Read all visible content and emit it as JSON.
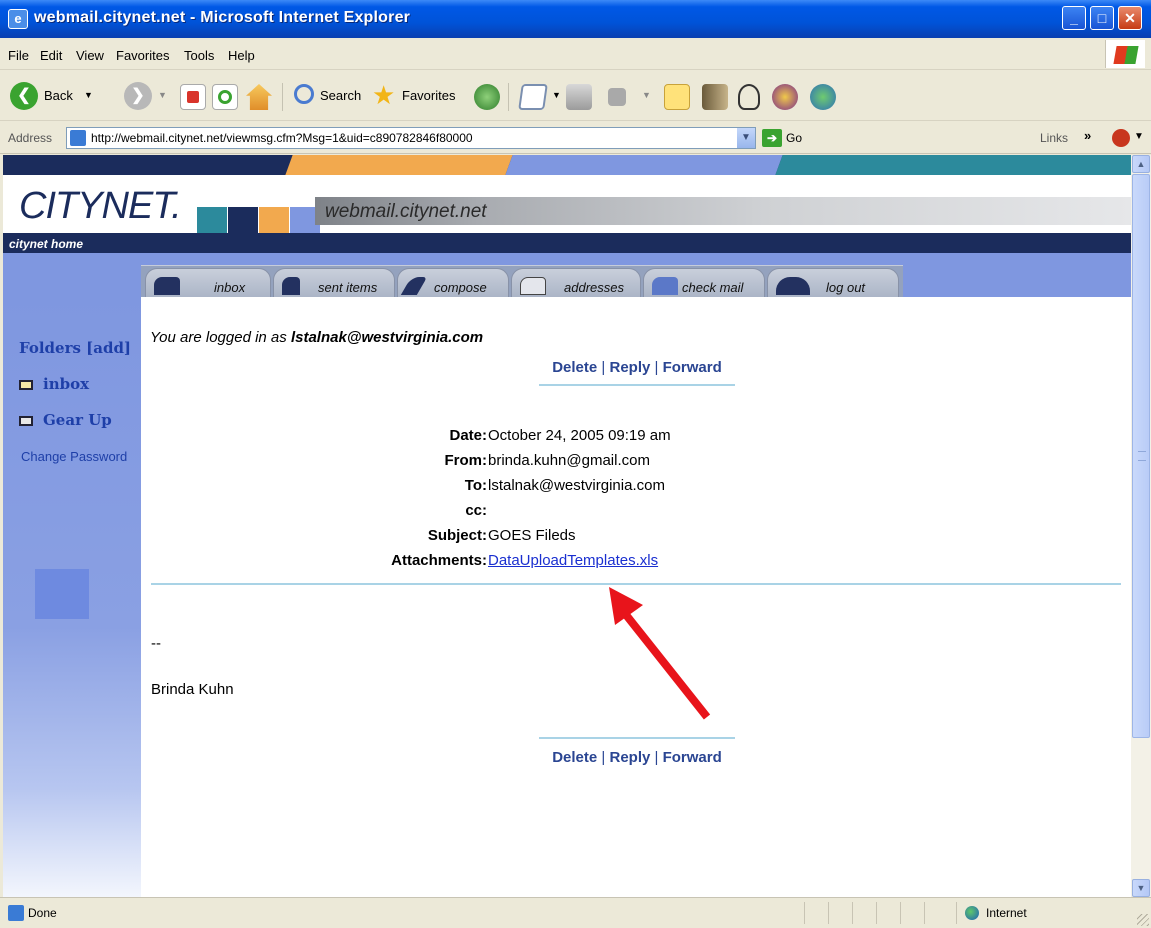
{
  "window": {
    "title": "webmail.citynet.net - Microsoft Internet Explorer",
    "minimize": "_",
    "maximize": "□",
    "close": "✕"
  },
  "menu": [
    "File",
    "Edit",
    "View",
    "Favorites",
    "Tools",
    "Help"
  ],
  "toolbar": {
    "back_label": "Back",
    "search_label": "Search",
    "favorites_label": "Favorites"
  },
  "address": {
    "label": "Address",
    "url": "http://webmail.citynet.net/viewmsg.cfm?Msg=1&uid=c890782846f80000",
    "go_label": "Go",
    "links_label": "Links",
    "links_chevron": "»"
  },
  "site": {
    "logo": "CITYNET.",
    "domain": "webmail.citynet.net",
    "home_link": "citynet home",
    "tabs": [
      "inbox",
      "sent items",
      "compose",
      "addresses",
      "check mail",
      "log out"
    ],
    "colors": {
      "navy": "#1B2C5C",
      "teal": "#2C8A9C",
      "orange": "#F2A94E",
      "periwinkle": "#7F97E0"
    }
  },
  "sidebar": {
    "folders_heading": "Folders [add]",
    "folders": [
      "inbox",
      "Gear Up"
    ],
    "change_password": "Change Password"
  },
  "message": {
    "logged_in_prefix": "You are logged in as ",
    "logged_in_user": "lstalnak@westvirginia.com",
    "actions": {
      "delete": "Delete",
      "reply": "Reply",
      "forward": "Forward",
      "separator": "|"
    },
    "headers": {
      "date_label": "Date:",
      "date": "October 24, 2005 09:19 am",
      "from_label": "From:",
      "from": "brinda.kuhn@gmail.com",
      "to_label": "To:",
      "to": "lstalnak@westvirginia.com",
      "cc_label": "cc:",
      "cc": "",
      "subject_label": "Subject:",
      "subject": "GOES Fileds",
      "attachments_label": "Attachments:",
      "attachment": "DataUploadTemplates.xls"
    },
    "body": {
      "dash": "--",
      "signature": "Brinda Kuhn"
    }
  },
  "status": {
    "text": "Done",
    "zone": "Internet"
  }
}
